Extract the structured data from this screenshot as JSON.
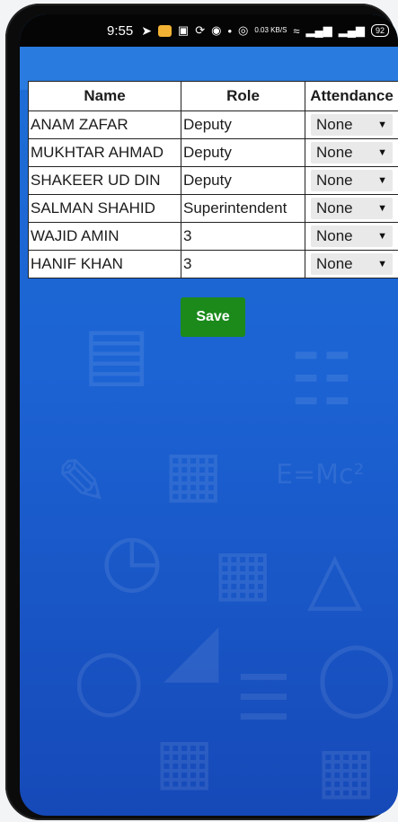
{
  "status_bar": {
    "time": "9:55",
    "network_speed": "0.03 KB/S",
    "battery": "92"
  },
  "table": {
    "headers": [
      "Name",
      "Role",
      "Attendance"
    ],
    "rows": [
      {
        "name": "ANAM ZAFAR",
        "role": "Deputy",
        "attendance": "None"
      },
      {
        "name": "MUKHTAR AHMAD",
        "role": "Deputy",
        "attendance": "None"
      },
      {
        "name": "SHAKEER UD DIN",
        "role": "Deputy",
        "attendance": "None"
      },
      {
        "name": "SALMAN SHAHID",
        "role": "Superintendent",
        "attendance": "None"
      },
      {
        "name": "WAJID AMIN",
        "role": "3",
        "attendance": "None"
      },
      {
        "name": "HANIF KHAN",
        "role": "3",
        "attendance": "None"
      }
    ]
  },
  "save_label": "Save",
  "colors": {
    "background": "#1e6fd6",
    "save_button": "#1b8a1b"
  }
}
